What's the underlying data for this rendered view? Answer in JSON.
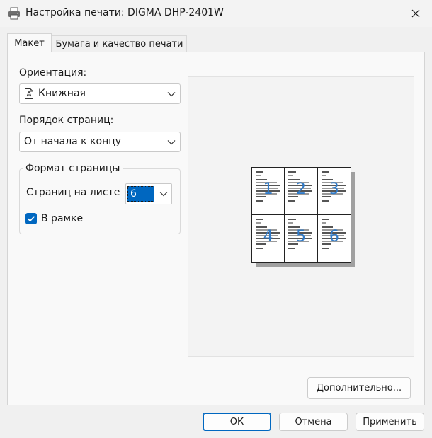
{
  "window": {
    "title": "Настройка печати: DIGMA DHP-2401W"
  },
  "tabs": [
    {
      "label": "Макет",
      "active": true
    },
    {
      "label": "Бумага и качество печати",
      "active": false
    }
  ],
  "layout_tab": {
    "orientation": {
      "label": "Ориентация:",
      "value": "Книжная"
    },
    "page_order": {
      "label": "Порядок страниц:",
      "value": "От начала к концу"
    },
    "page_format": {
      "group_label": "Формат страницы",
      "pages_per_sheet_label": "Страниц на листе",
      "pages_per_sheet_value": "6",
      "border_label": "В рамке",
      "border_checked": true
    },
    "preview": {
      "page_numbers": [
        "1",
        "2",
        "3",
        "4",
        "5",
        "6"
      ]
    },
    "advanced_button": "Дополнительно..."
  },
  "buttons": {
    "ok": "ОК",
    "cancel": "Отмена",
    "apply": "Применить"
  },
  "colors": {
    "accent": "#0067c0",
    "preview_numbers": "#2f7ac8"
  }
}
